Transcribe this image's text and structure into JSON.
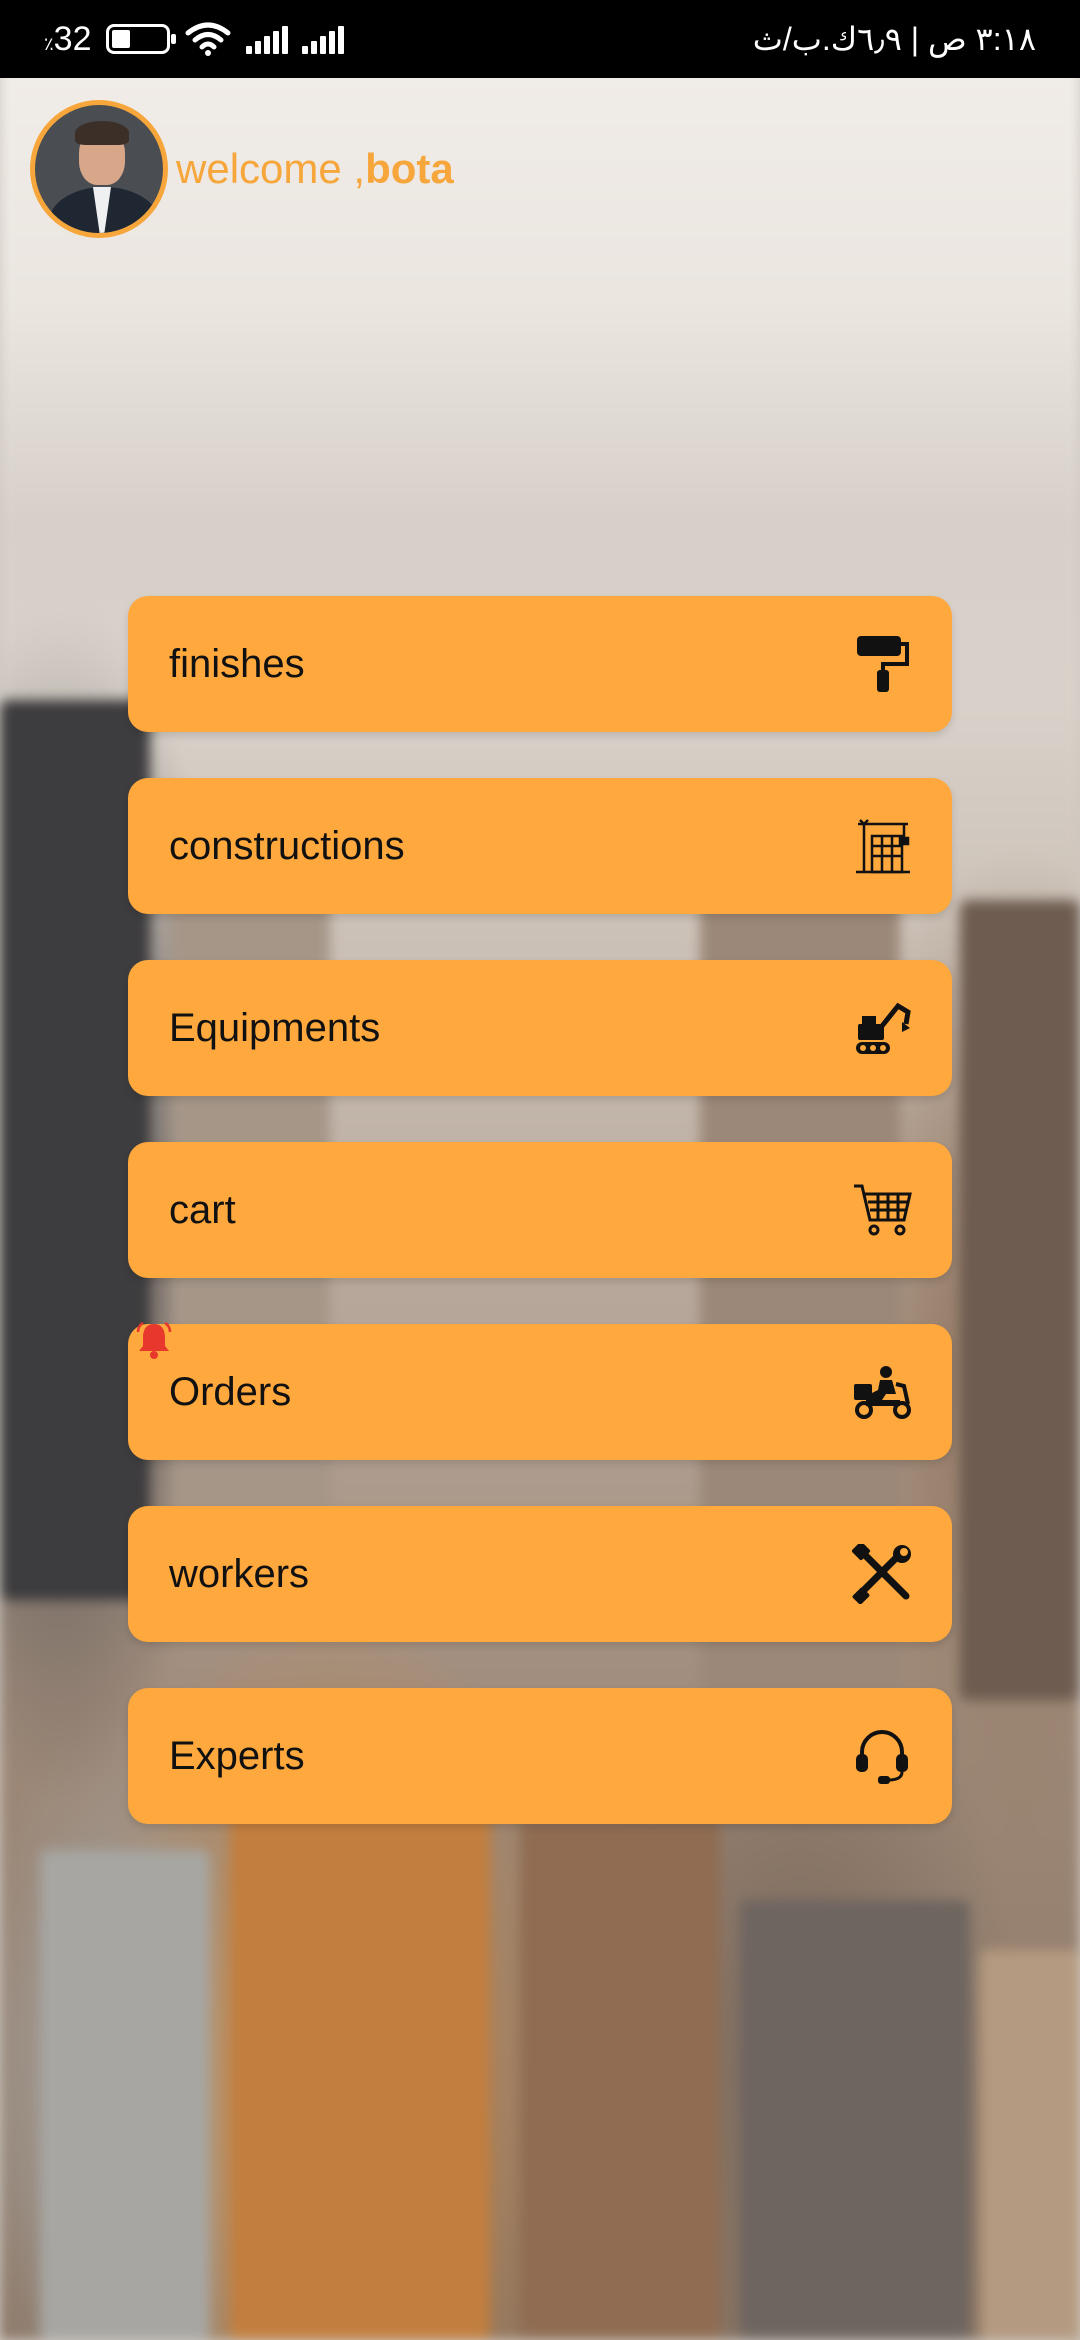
{
  "status_bar": {
    "battery_level": "32",
    "battery_percent_sign": "٪",
    "right_text": "٣:١٨ ص | ٦٫٩ك.ب/ث"
  },
  "header": {
    "welcome_text": "welcome ,",
    "username": "bota"
  },
  "menu": {
    "items": [
      {
        "label": "finishes",
        "icon": "paint-roller-icon"
      },
      {
        "label": "constructions",
        "icon": "building-crane-icon"
      },
      {
        "label": "Equipments",
        "icon": "excavator-icon"
      },
      {
        "label": "cart",
        "icon": "shopping-cart-icon"
      },
      {
        "label": "Orders",
        "icon": "delivery-scooter-icon",
        "badge": "bell-icon"
      },
      {
        "label": "workers",
        "icon": "tools-icon"
      },
      {
        "label": "Experts",
        "icon": "headset-icon"
      }
    ]
  },
  "colors": {
    "accent": "#fea83d",
    "welcome": "#f6a63a",
    "notification": "#e8372c"
  }
}
